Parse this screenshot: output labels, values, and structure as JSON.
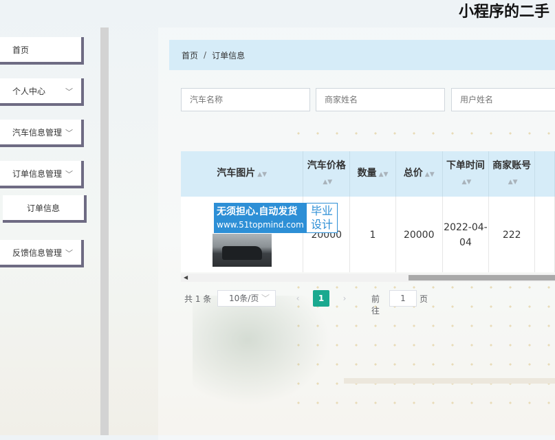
{
  "app": {
    "title": "小程序的二手"
  },
  "sidebar": {
    "items": [
      {
        "label": "首页"
      },
      {
        "label": "个人中心"
      },
      {
        "label": "汽车信息管理"
      },
      {
        "label": "订单信息管理"
      },
      {
        "label": "订单信息"
      },
      {
        "label": "反馈信息管理"
      }
    ]
  },
  "breadcrumb": {
    "home": "首页",
    "separator": "/",
    "current": "订单信息"
  },
  "search": {
    "car_name_placeholder": "汽车名称",
    "merchant_name_placeholder": "商家姓名",
    "user_name_placeholder": "用户姓名"
  },
  "table": {
    "columns": [
      "汽车图片",
      "汽车价格",
      "数量",
      "总价",
      "下单时间",
      "商家账号"
    ],
    "rows": [
      {
        "price": "20000",
        "quantity": "1",
        "total": "20000",
        "order_time": "2022-04-04",
        "merchant_account": "222"
      }
    ]
  },
  "watermark": {
    "line1": "无须担心.自动发货",
    "line2": "www.51topmind.com",
    "badge1": "毕业",
    "badge2": "设计"
  },
  "pagination": {
    "total": "共 1 条",
    "page_size": "10条/页",
    "current_page": "1",
    "goto_label": "前往",
    "goto_value": "1",
    "goto_unit": "页"
  },
  "icons": {
    "chevron": "chevron-down-icon",
    "sort": "sort-icon"
  },
  "colors": {
    "accent": "#1aa98f",
    "header_bg": "#d6ecf8",
    "menu_border": "#6e6b83"
  }
}
